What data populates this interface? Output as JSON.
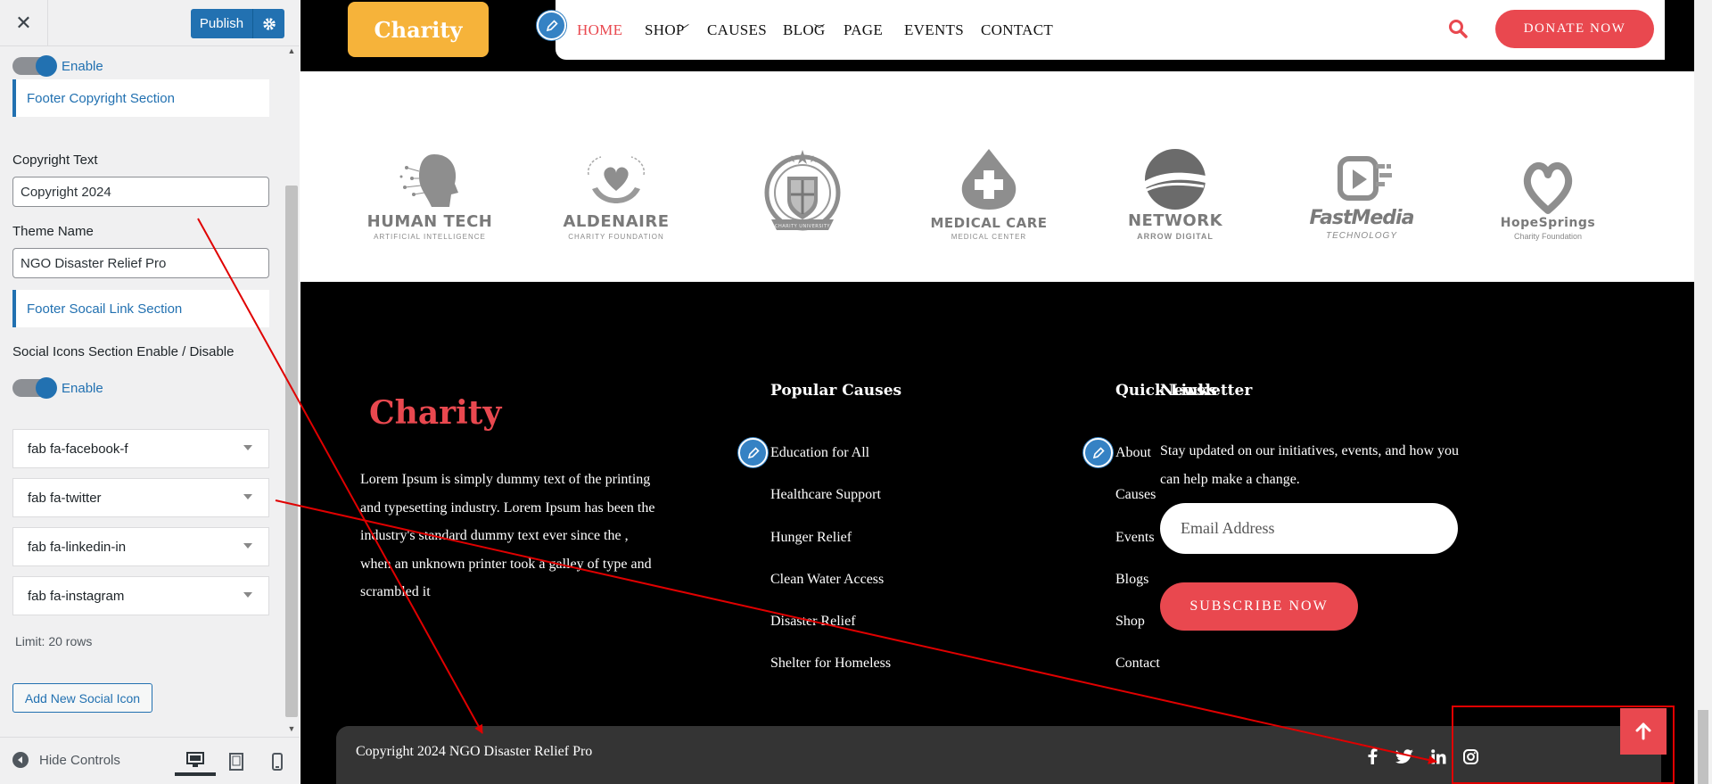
{
  "customizer": {
    "close_icon": "close-icon",
    "publish_label": "Publish",
    "copyright_toggle_label": "Enable",
    "footer_copyright_section": "Footer Copyright Section",
    "copyright_text_label": "Copyright Text",
    "copyright_text_value": "Copyright 2024",
    "theme_name_label": "Theme Name",
    "theme_name_value": "NGO Disaster Relief Pro",
    "footer_social_section": "Footer Socail Link Section",
    "social_toggle_title": "Social Icons Section Enable / Disable",
    "social_toggle_label": "Enable",
    "social_icons": [
      {
        "label": "fab fa-facebook-f"
      },
      {
        "label": "fab fa-twitter"
      },
      {
        "label": "fab fa-linkedin-in"
      },
      {
        "label": "fab fa-instagram"
      }
    ],
    "limit_text": "Limit: 20 rows",
    "add_button": "Add New Social Icon",
    "hide_controls": "Hide Controls"
  },
  "site": {
    "logo": "Charity",
    "nav": [
      {
        "label": "HOME",
        "active": true
      },
      {
        "label": "SHOP",
        "dropdown": true
      },
      {
        "label": "CAUSES"
      },
      {
        "label": "BLOG",
        "dropdown": true
      },
      {
        "label": "PAGE"
      },
      {
        "label": "EVENTS"
      },
      {
        "label": "CONTACT"
      }
    ],
    "donate_button": "DONATE NOW",
    "partners": [
      {
        "name": "HUMAN TECH",
        "sub": "ARTIFICIAL INTELLIGENCE"
      },
      {
        "name": "ALDENAIRE",
        "sub": "CHARITY FOUNDATION"
      },
      {
        "name": "",
        "sub": "CHARITY UNIVERSITY"
      },
      {
        "name": "MEDICAL CARE",
        "sub": "MEDICAL CENTER"
      },
      {
        "name": "NETWORK",
        "sub": "ARROW DIGITAL"
      },
      {
        "name": "FastMedia",
        "sub": "TECHNOLOGY"
      },
      {
        "name": "HopeSprings",
        "sub": "Charity Foundation"
      }
    ]
  },
  "footer": {
    "logo": "Charity",
    "about": "Lorem Ipsum is simply dummy text of the printing and typesetting industry. Lorem Ipsum has been the industry's standard dummy text ever since the , when an unknown printer took a galley of type and scrambled it",
    "popular_causes_title": "Popular Causes",
    "popular_causes": [
      "Education for All",
      "Healthcare Support",
      "Hunger Relief",
      "Clean Water Access",
      "Disaster Relief",
      "Shelter for Homeless"
    ],
    "quick_links_title": "Quick Links",
    "quick_links": [
      "About",
      "Causes",
      "Events",
      "Blogs",
      "Shop",
      "Contact"
    ],
    "newsletter_title": "Newsletter",
    "newsletter_text": "Stay updated on our initiatives, events, and how you can help make a change.",
    "email_placeholder": "Email Address",
    "subscribe_button": "SUBSCRIBE NOW",
    "copyright": "Copyright 2024 NGO Disaster Relief Pro",
    "social_icons": [
      "facebook-icon",
      "twitter-icon",
      "linkedin-icon",
      "instagram-icon"
    ]
  },
  "colors": {
    "accent": "#e9484f",
    "brand_yellow": "#f6b33a",
    "wp_blue": "#2271b1",
    "annotation_red": "#e00000"
  }
}
